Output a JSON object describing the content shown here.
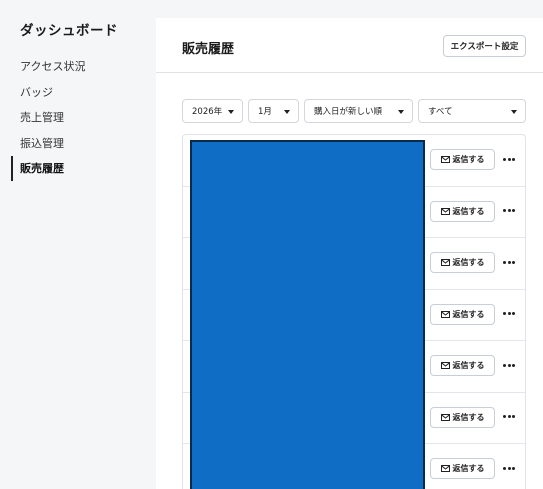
{
  "sidebar": {
    "title": "ダッシュボード",
    "items": [
      {
        "label": "アクセス状況",
        "active": false
      },
      {
        "label": "バッジ",
        "active": false
      },
      {
        "label": "売上管理",
        "active": false
      },
      {
        "label": "振込管理",
        "active": false
      },
      {
        "label": "販売履歴",
        "active": true
      }
    ]
  },
  "header": {
    "title": "販売履歴",
    "export_label": "エクスポート設定"
  },
  "filters": {
    "year": "2026年",
    "month": "1月",
    "sort": "購入日が新しい順",
    "status": "すべて"
  },
  "rows": [
    {
      "reply_label": "返信する",
      "more_icon": "more-horizontal-icon"
    },
    {
      "reply_label": "返信する",
      "more_icon": "more-horizontal-icon"
    },
    {
      "reply_label": "返信する",
      "more_icon": "more-horizontal-icon"
    },
    {
      "reply_label": "返信する",
      "more_icon": "more-horizontal-icon"
    },
    {
      "reply_label": "返信する",
      "more_icon": "more-horizontal-icon"
    },
    {
      "reply_label": "返信する",
      "more_icon": "more-horizontal-icon"
    },
    {
      "reply_label": "返信する",
      "more_icon": "more-horizontal-icon"
    }
  ],
  "colors": {
    "redaction": "#0f6dc6",
    "background": "#f4f6f8"
  }
}
